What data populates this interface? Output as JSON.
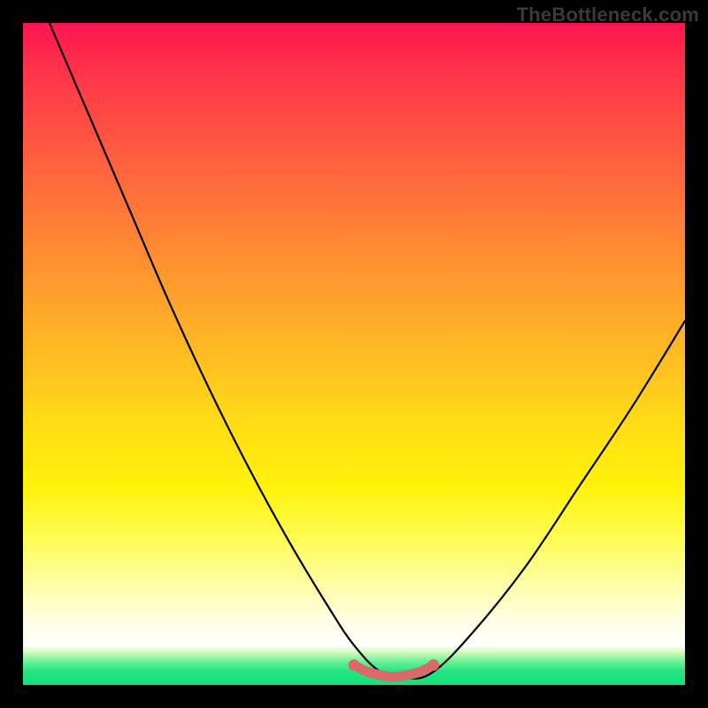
{
  "watermark": "TheBottleneck.com",
  "chart_data": {
    "type": "line",
    "title": "",
    "xlabel": "",
    "ylabel": "",
    "xlim": [
      0,
      100
    ],
    "ylim": [
      0,
      100
    ],
    "grid": false,
    "series": [
      {
        "name": "bottleneck-curve",
        "color": "#000000",
        "x": [
          4,
          10,
          16,
          22,
          28,
          34,
          40,
          46,
          50,
          54,
          58,
          62,
          68,
          76,
          84,
          92,
          100
        ],
        "y": [
          100,
          86,
          72,
          58,
          45,
          33,
          22,
          12,
          6,
          2,
          1,
          2,
          8,
          18,
          30,
          42,
          55
        ]
      },
      {
        "name": "optimal-zone",
        "color": "#d96a6a",
        "x": [
          50,
          52,
          54,
          56,
          58,
          60,
          62
        ],
        "y": [
          3.0,
          2.0,
          1.5,
          1.2,
          1.5,
          2.0,
          3.0
        ]
      }
    ],
    "gradient_stops": [
      {
        "pos": 0,
        "color": "#ff1450"
      },
      {
        "pos": 50,
        "color": "#ffc81e"
      },
      {
        "pos": 90,
        "color": "#ffffff"
      },
      {
        "pos": 100,
        "color": "#18df7d"
      }
    ]
  }
}
